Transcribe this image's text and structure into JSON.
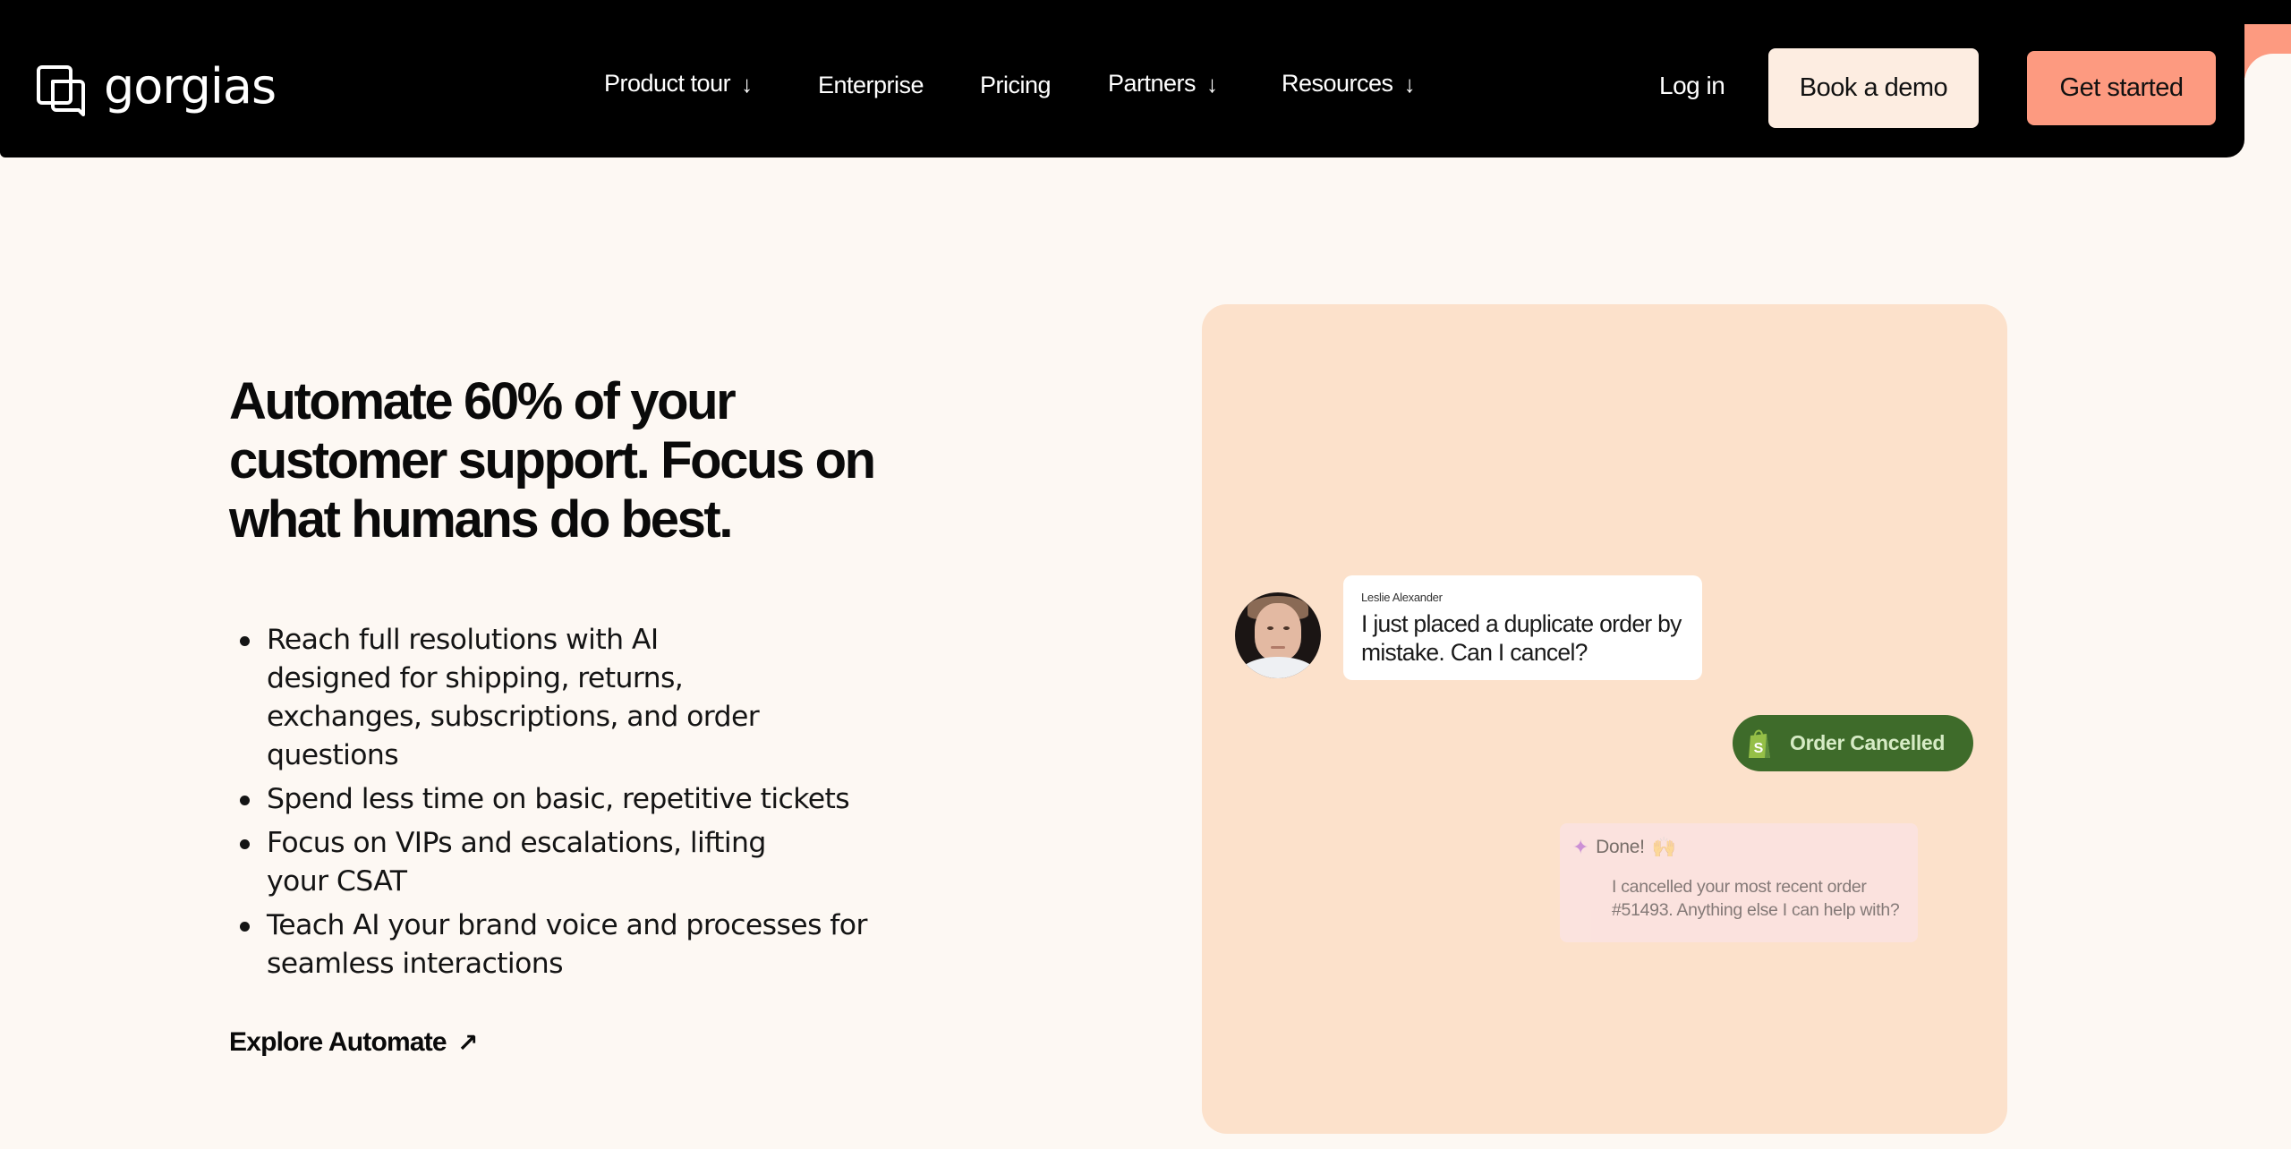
{
  "nav": {
    "brand": "gorgias",
    "logo_icon": "gorgias-logo-icon",
    "items": [
      {
        "label": "Product tour",
        "has_dropdown": true,
        "icon": "arrow-down-icon",
        "glyph": "↓"
      },
      {
        "label": "Enterprise",
        "has_dropdown": false
      },
      {
        "label": "Pricing",
        "has_dropdown": false
      },
      {
        "label": "Partners",
        "has_dropdown": true,
        "icon": "arrow-down-icon",
        "glyph": "↓"
      },
      {
        "label": "Resources",
        "has_dropdown": true,
        "icon": "arrow-down-icon",
        "glyph": "↓"
      }
    ],
    "login": "Log in",
    "book_demo": "Book a demo",
    "get_started": "Get started"
  },
  "hero": {
    "title": "Automate 60% of your customer support. Focus on what humans do best.",
    "bullets": [
      "Reach full resolutions with AI designed for shipping, returns, exchanges, subscriptions, and order questions",
      "Spend less time on basic, repetitive tickets",
      "Focus on VIPs and escalations, lifting your CSAT",
      "Teach AI your brand voice and processes for seamless interactions"
    ],
    "cta": "Explore Automate",
    "cta_icon_glyph": "↗"
  },
  "demo_chat": {
    "customer": {
      "name": "Leslie Alexander",
      "message": "I just placed a duplicate order by mistake. Can I cancel?"
    },
    "status_pill": {
      "label": "Order Cancelled",
      "icon": "shopify-bag-icon"
    },
    "ai_reply": {
      "sparkle_glyph": "✦",
      "headline": "Done!",
      "emoji": "🙌",
      "message": "I cancelled your most recent order #51493. Anything else I can help with?"
    }
  },
  "colors": {
    "page_bg": "#FDF8F3",
    "nav_bg": "#000000",
    "accent_salmon": "#FD9A80",
    "demo_button_bg": "#FDEDE1",
    "card_bg": "#FCE1CB",
    "pill_bg": "#3E6B2A",
    "pill_text": "#D6EBC5",
    "reply_bg": "#FBE3E0"
  }
}
